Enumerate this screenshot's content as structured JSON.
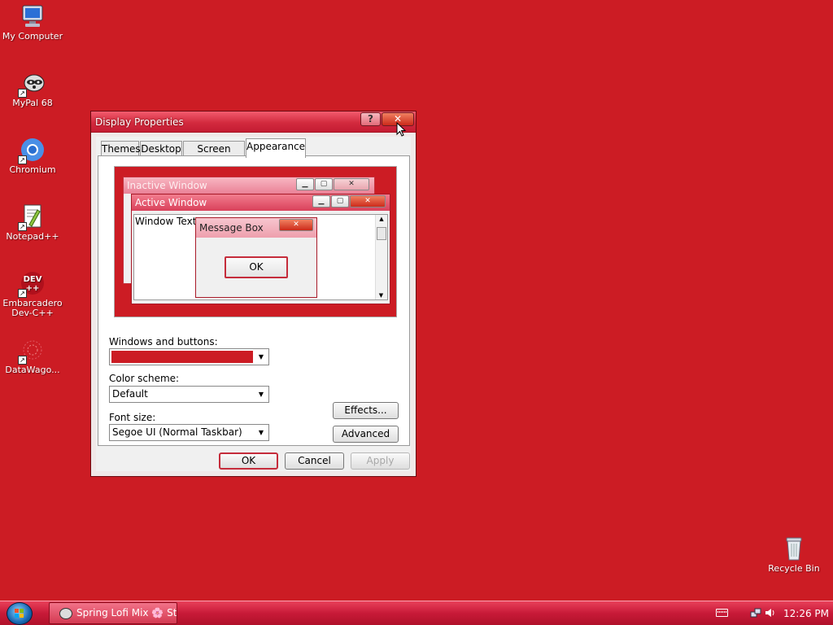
{
  "desktop": {
    "background_color": "#cc1c24",
    "icons": [
      {
        "label": "My Computer",
        "icon": "computer-icon"
      },
      {
        "label": "MyPal 68",
        "icon": "raccoon-icon"
      },
      {
        "label": "Chromium",
        "icon": "chromium-icon"
      },
      {
        "label": "Notepad++",
        "icon": "notepadpp-icon"
      },
      {
        "label": "Embarcadero Dev-C++",
        "label_line1": "Embarcadero",
        "label_line2": "Dev-C++",
        "icon": "devcpp-icon"
      },
      {
        "label": "DataWago...",
        "icon": "datawagon-icon"
      },
      {
        "label": "Recycle Bin",
        "icon": "recycle-bin-icon"
      }
    ]
  },
  "window": {
    "title": "Display Properties",
    "help_label": "?",
    "close_label": "✕",
    "tabs": [
      "Themes",
      "Desktop",
      "Screen Saver",
      "Appearance"
    ],
    "active_tab": "Appearance",
    "preview": {
      "inactive_title": "Inactive Window",
      "active_title": "Active Window",
      "window_text": "Window Text",
      "message_box_title": "Message Box",
      "ok_label": "OK"
    },
    "windows_and_buttons_label": "Windows and buttons:",
    "windows_and_buttons_color": "#cc1c24",
    "color_scheme_label": "Color scheme:",
    "color_scheme_value": "Default",
    "font_size_label": "Font size:",
    "font_size_value": "Segoe UI (Normal Taskbar)",
    "effects_label": "Effects...",
    "advanced_label": "Advanced",
    "ok_label": "OK",
    "cancel_label": "Cancel",
    "apply_label": "Apply"
  },
  "taskbar": {
    "task_label": "Spring Lofi Mix 🌸 St...",
    "clock": "12:26 PM"
  }
}
